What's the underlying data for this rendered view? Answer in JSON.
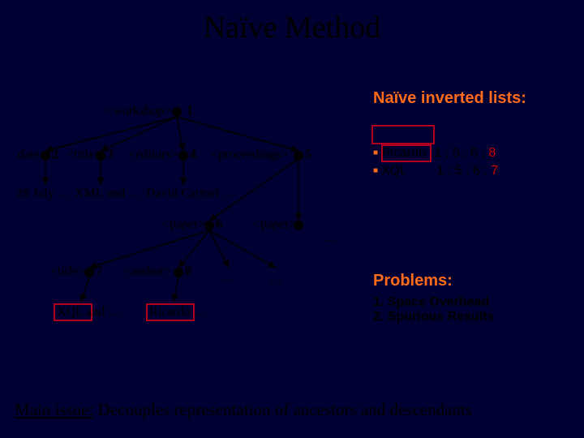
{
  "title": "Naïve Method",
  "tree": {
    "nodes": {
      "n1": {
        "label": "<workshop>",
        "num": "1",
        "content": ""
      },
      "n2": {
        "label": "date",
        "num": "2",
        "content": "28 July …"
      },
      "n3": {
        "label": "<title>",
        "num": "3",
        "content": "XML and …"
      },
      "n4": {
        "label": "<editors>",
        "num": "4",
        "content": "David Carmel …"
      },
      "n5": {
        "label": "<proceedings>",
        "num": "5",
        "content": ""
      },
      "n6": {
        "label": "<paper>",
        "num": "6",
        "content": ""
      },
      "n6b": {
        "label": "<paper>",
        "num": "",
        "content": "…."
      },
      "n7": {
        "label": "<title>",
        "num": "7",
        "content": "XQL and …"
      },
      "n8": {
        "label": "<author>",
        "num": "8",
        "content": "Ricardo …"
      },
      "n8a": {
        "label": "",
        "num": "",
        "content": "…"
      },
      "n8b": {
        "label": "",
        "num": "",
        "content": "…"
      }
    }
  },
  "inverted": {
    "heading": "Naïve inverted lists:",
    "rows": [
      {
        "term": "Ricardo",
        "ids": "1 ; 5 ; 6 ;",
        "extra": "8"
      },
      {
        "term": "XQL",
        "ids": "1 ; 5 ; 6 ;",
        "extra": "7"
      }
    ]
  },
  "problems": {
    "heading": "Problems:",
    "items": [
      "1. Space Overhead",
      "2. Spurious Results"
    ]
  },
  "footer": {
    "lead": "Main issue:",
    "rest": " Decouples representation of ancestors and descendants"
  }
}
